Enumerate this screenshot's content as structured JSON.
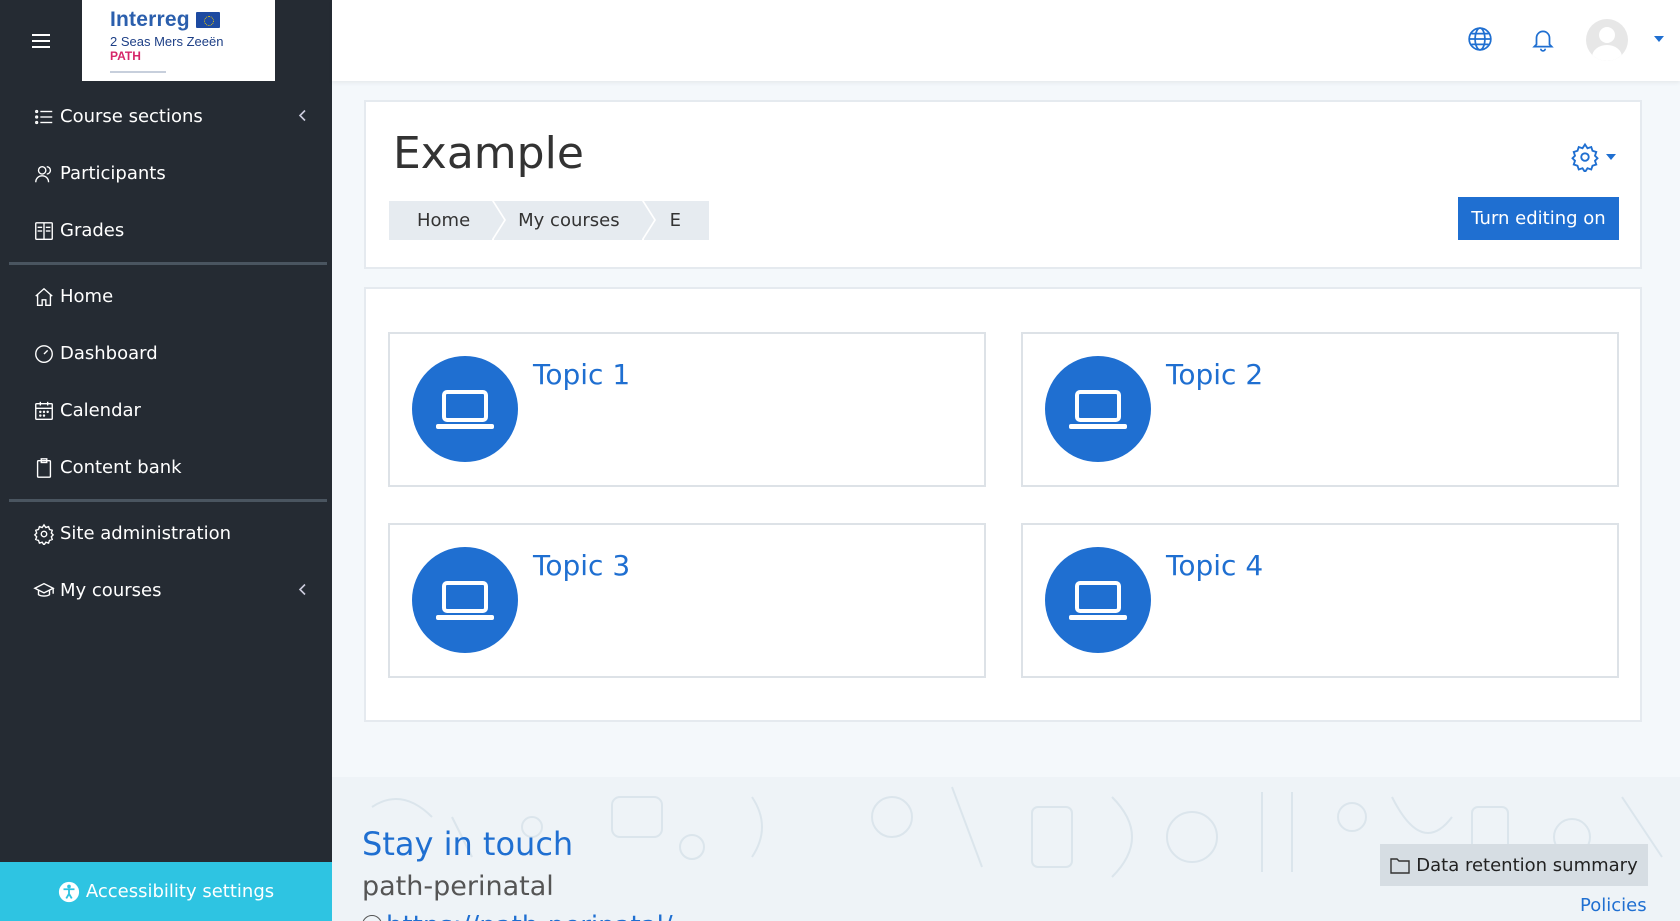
{
  "brand": {
    "name": "Interreg",
    "sub": "2 Seas Mers Zeeën",
    "project": "PATH"
  },
  "sidebar": {
    "items": [
      {
        "label": "Course sections"
      },
      {
        "label": "Participants"
      },
      {
        "label": "Grades"
      },
      {
        "label": "Home"
      },
      {
        "label": "Dashboard"
      },
      {
        "label": "Calendar"
      },
      {
        "label": "Content bank"
      },
      {
        "label": "Site administration"
      },
      {
        "label": "My courses"
      }
    ],
    "accessibility_label": "Accessibility settings"
  },
  "page": {
    "title": "Example",
    "breadcrumb": [
      "Home",
      "My courses",
      "E"
    ],
    "edit_button": "Turn editing on"
  },
  "topics": [
    {
      "name": "Topic 1"
    },
    {
      "name": "Topic 2"
    },
    {
      "name": "Topic 3"
    },
    {
      "name": "Topic 4"
    }
  ],
  "footer": {
    "stay_title": "Stay in touch",
    "stay_sub": "path-perinatal",
    "stay_link": "https://path-perinatal/",
    "retention_button": "Data retention summary",
    "policies": "Policies"
  },
  "colors": {
    "primary": "#1f6fd1",
    "sidebar_bg": "#252b33",
    "accessibility_bar": "#2ec4e2"
  }
}
